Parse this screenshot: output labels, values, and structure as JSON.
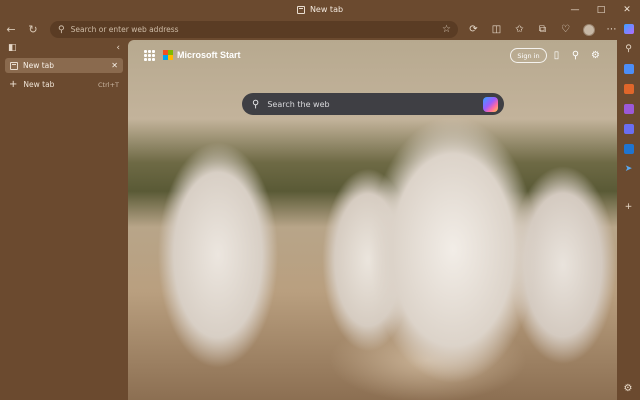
{
  "window": {
    "title": "New tab"
  },
  "toolbar": {
    "address_placeholder": "Search or enter web address"
  },
  "sidebar": {
    "tabs": [
      {
        "label": "New tab"
      }
    ],
    "new_tab": {
      "label": "New tab",
      "shortcut": "Ctrl+T"
    }
  },
  "ntp": {
    "brand": "Microsoft Start",
    "signin_label": "Sign in",
    "search_placeholder": "Search the web"
  },
  "colors": {
    "frame": "#6b4a2f",
    "address_bg": "#5a3c24",
    "active_tab_bg": "#8a6a4e",
    "search_bg": "#3f3f44"
  },
  "icons": {
    "back": "arrow-left-icon",
    "refresh": "refresh-icon",
    "favorite": "star-icon",
    "apps": "app-launcher-icon",
    "settings": "gear-icon",
    "copilot": "copilot-icon"
  }
}
